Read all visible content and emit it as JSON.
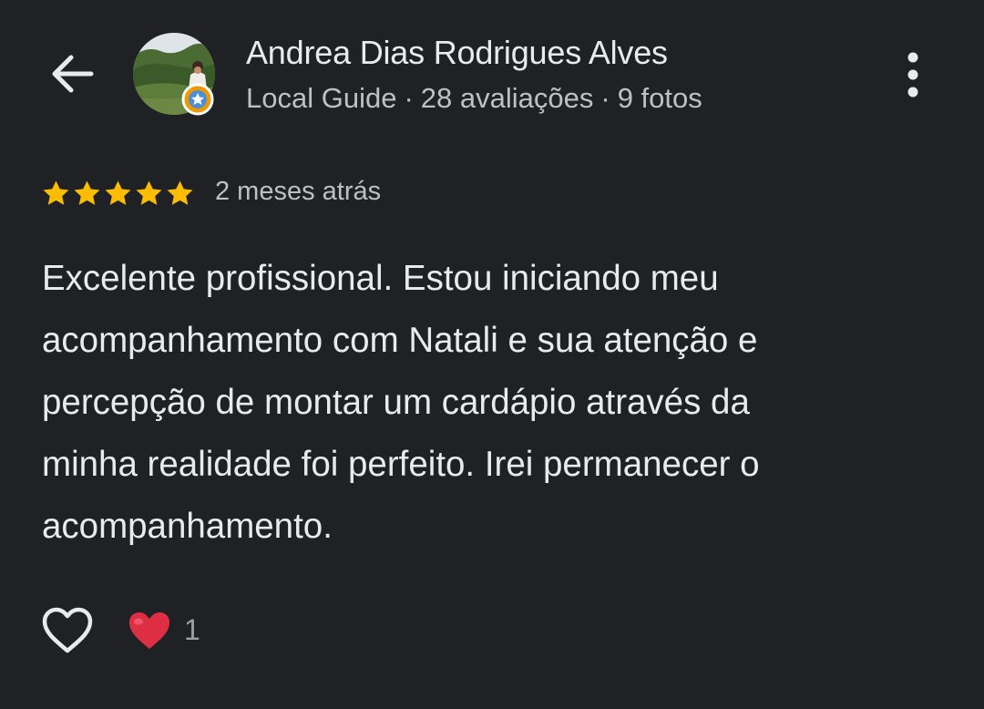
{
  "header": {
    "back_icon": "arrow-left-icon",
    "reviewer_name": "Andrea Dias Rodrigues Alves",
    "reviewer_badge_icon": "local-guide-star-icon",
    "meta_parts": [
      "Local Guide",
      "·",
      "28 avaliações",
      "·",
      "9 fotos"
    ],
    "more_icon": "more-vert-icon"
  },
  "review": {
    "rating": 5,
    "rating_max": 5,
    "time_ago": "2 meses atrás",
    "text_lines": [
      "Excelente profissional. Estou iniciando meu",
      "acompanhamento com Natali e sua atenção e",
      "percepção de montar um cardápio através da",
      "minha realidade foi perfeito. Irei permanecer o",
      "acompanhamento."
    ]
  },
  "reactions": {
    "like_icon": "heart-outline-icon",
    "reaction_icon": "red-heart-icon",
    "count": "1"
  },
  "colors": {
    "background": "#202124",
    "primary_text": "#e8eaed",
    "secondary_text": "#bdc1c6",
    "star": "#fbbc04",
    "heart": "#dd2e44"
  }
}
